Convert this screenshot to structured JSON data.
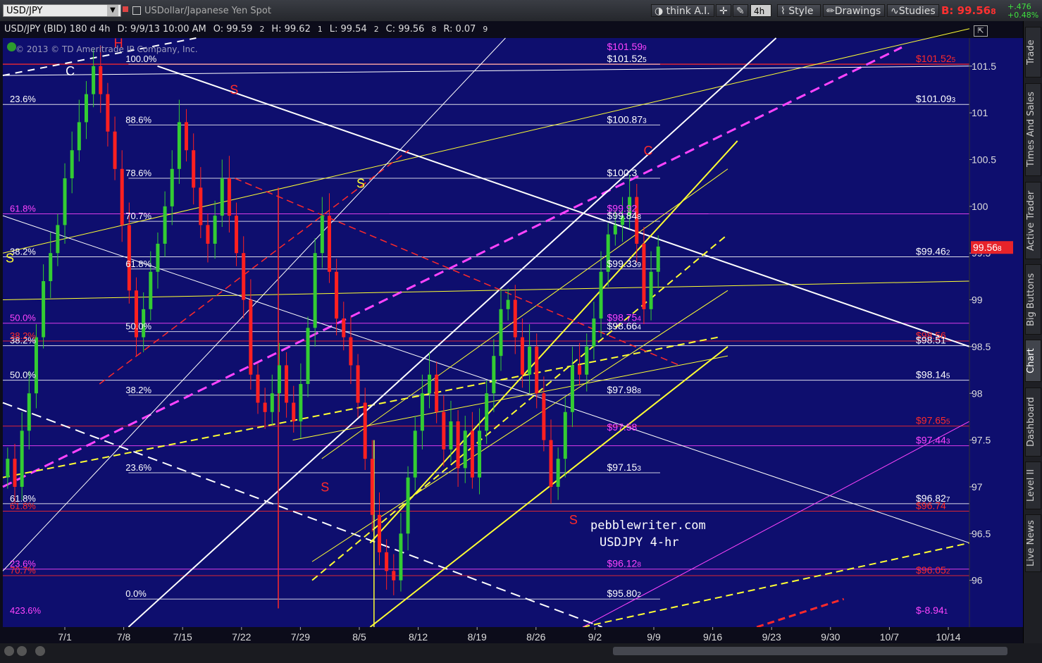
{
  "toolbar": {
    "symbol": "USD/JPY",
    "description": "USDollar/Japanese Yen Spot",
    "think": "think A.I.",
    "timeframe": "4h",
    "style": "Style",
    "drawings": "Drawings",
    "studies": "Studies",
    "bid": "B: 99.56",
    "bid_small": "8",
    "change": "+.476",
    "change_pct": "+0.48%"
  },
  "info": {
    "title": "USD/JPY (BID) 180 d 4h",
    "date": "D: 9/9/13 10:00 AM",
    "open": "O: 99.59",
    "open_small": "2",
    "high": "H: 99.62",
    "high_small": "1",
    "low": "L: 99.54",
    "low_small": "2",
    "close": "C: 99.56",
    "close_small": "8",
    "range": "R: 0.07",
    "range_small": "9"
  },
  "watermark": "© 2013 © TD Ameritrade IP Company, Inc.",
  "annotation": {
    "line1": "pebblewriter.com",
    "line2": "USDJPY 4-hr"
  },
  "side_tabs": [
    "Trade",
    "Times And Sales",
    "Active Trader",
    "Big Buttons",
    "Chart",
    "Dashboard",
    "Level II",
    "Live News"
  ],
  "colors": {
    "background": "#0e0e6e",
    "up": "#33cc33",
    "down": "#ff2020",
    "fib": "#ffffff",
    "magenta": "#ff44ff",
    "yellow": "#ffff33",
    "red": "#ff2a2a"
  },
  "chart_data": {
    "type": "candlestick",
    "y_axis": {
      "min": 95.5,
      "max": 101.8,
      "ticks": [
        "101.5",
        "101",
        "100.5",
        "100",
        "99.5",
        "99",
        "98.5",
        "98",
        "97.5",
        "97",
        "96.5",
        "96"
      ]
    },
    "x_ticks": [
      "7/1",
      "7/8",
      "7/15",
      "7/22",
      "7/29",
      "8/5",
      "8/12",
      "8/19",
      "8/26",
      "9/2",
      "9/9",
      "9/16",
      "9/23",
      "9/30",
      "10/7",
      "10/14"
    ],
    "last_price": "99.56",
    "last_price_small": "8",
    "price_labels": [
      {
        "text": "$101.52",
        "small": "5",
        "price": 101.52,
        "color": "#ff2a2a"
      },
      {
        "text": "$101.09",
        "small": "3",
        "price": 101.09,
        "color": "#ffffff"
      },
      {
        "text": "$99.46",
        "small": "2",
        "price": 99.46,
        "color": "#ffffff"
      },
      {
        "text": "$98.56",
        "small": "",
        "price": 98.56,
        "color": "#ff2a2a"
      },
      {
        "text": "$98.51",
        "small": "",
        "price": 98.51,
        "color": "#ffffff"
      },
      {
        "text": "$98.14",
        "small": "5",
        "price": 98.14,
        "color": "#ffffff"
      },
      {
        "text": "$97.65",
        "small": "5",
        "price": 97.65,
        "color": "#ff2a2a"
      },
      {
        "text": "$97.44",
        "small": "3",
        "price": 97.44,
        "color": "#ff44ff"
      },
      {
        "text": "$96.82",
        "small": "7",
        "price": 96.82,
        "color": "#ffffff"
      },
      {
        "text": "$96.74",
        "small": "",
        "price": 96.74,
        "color": "#ff2a2a"
      },
      {
        "text": "$96.05",
        "small": "2",
        "price": 96.05,
        "color": "#ff2a2a"
      },
      {
        "text": "$-8.94",
        "small": "1",
        "price": 95.62,
        "color": "#ff44ff"
      }
    ],
    "mid_labels": [
      {
        "text": "$101.52",
        "small": "5",
        "price": 101.52,
        "color": "#ffffff"
      },
      {
        "text": "$101.59",
        "small": "9",
        "price": 101.65,
        "color": "#ff44ff"
      },
      {
        "text": "$100.87",
        "small": "3",
        "price": 100.87,
        "color": "#ffffff"
      },
      {
        "text": "$100.3",
        "small": "",
        "price": 100.3,
        "color": "#ffffff"
      },
      {
        "text": "$99.92",
        "small": "",
        "price": 99.92,
        "color": "#ff44ff"
      },
      {
        "text": "$99.84",
        "small": "8",
        "price": 99.84,
        "color": "#ffffff"
      },
      {
        "text": "$99.33",
        "small": "9",
        "price": 99.33,
        "color": "#ffffff"
      },
      {
        "text": "$98.75",
        "small": "4",
        "price": 98.75,
        "color": "#ff44ff"
      },
      {
        "text": "$98.66",
        "small": "4",
        "price": 98.66,
        "color": "#ffffff"
      },
      {
        "text": "$97.98",
        "small": "8",
        "price": 97.98,
        "color": "#ffffff"
      },
      {
        "text": "$97.58",
        "small": "",
        "price": 97.58,
        "color": "#ff44ff"
      },
      {
        "text": "$97.15",
        "small": "3",
        "price": 97.15,
        "color": "#ffffff"
      },
      {
        "text": "$96.12",
        "small": "8",
        "price": 96.12,
        "color": "#ff44ff"
      },
      {
        "text": "$95.80",
        "small": "2",
        "price": 95.8,
        "color": "#ffffff"
      }
    ],
    "fib_left": [
      {
        "text": "23.6%",
        "price": 101.09,
        "color": "#ffffff"
      },
      {
        "text": "61.8%",
        "price": 99.92,
        "color": "#ff44ff"
      },
      {
        "text": "38.2%",
        "price": 99.46,
        "color": "#ffffff"
      },
      {
        "text": "50.0%",
        "price": 98.75,
        "color": "#ff44ff"
      },
      {
        "text": "38.2%",
        "price": 98.51,
        "color": "#ffffff"
      },
      {
        "text": "38.2%",
        "price": 98.56,
        "color": "#ff2a2a"
      },
      {
        "text": "50.0%",
        "price": 98.14,
        "color": "#ffffff"
      },
      {
        "text": "61.8%",
        "price": 96.82,
        "color": "#ffffff"
      },
      {
        "text": "61.8%",
        "price": 96.74,
        "color": "#ff2a2a"
      },
      {
        "text": "23.6%",
        "price": 96.12,
        "color": "#ff44ff"
      },
      {
        "text": "70.7%",
        "price": 96.05,
        "color": "#ff2a2a"
      },
      {
        "text": "423.6%",
        "price": 95.62,
        "color": "#ff44ff"
      }
    ],
    "fib_mid": [
      {
        "text": "100.0%",
        "price": 101.52
      },
      {
        "text": "88.6%",
        "price": 100.87
      },
      {
        "text": "78.6%",
        "price": 100.3
      },
      {
        "text": "70.7%",
        "price": 99.84
      },
      {
        "text": "61.8%",
        "price": 99.33
      },
      {
        "text": "50.0%",
        "price": 98.66
      },
      {
        "text": "38.2%",
        "price": 97.98
      },
      {
        "text": "23.6%",
        "price": 97.15
      },
      {
        "text": "0.0%",
        "price": 95.8
      }
    ],
    "letters": [
      {
        "t": "H",
        "color": "#ff2a2a",
        "x": 0.112,
        "price": 101.7
      },
      {
        "t": "C",
        "color": "#ffffff",
        "x": 0.062,
        "price": 101.4
      },
      {
        "t": "S",
        "color": "#ff2a2a",
        "x": 0.232,
        "price": 101.2
      },
      {
        "t": "S",
        "color": "#ffff33",
        "x": 0.363,
        "price": 100.2
      },
      {
        "t": "C",
        "color": "#ff2a2a",
        "x": 0.66,
        "price": 100.55
      },
      {
        "t": "S",
        "color": "#ff2a2a",
        "x": 0.326,
        "price": 96.95
      },
      {
        "t": "S",
        "color": "#ff2a2a",
        "x": 0.583,
        "price": 96.6
      },
      {
        "t": "S",
        "color": "#ffff33",
        "x": 0.0,
        "price": 99.4
      }
    ],
    "series": [
      {
        "name": "close",
        "values": [
          97.3,
          97.0,
          97.6,
          98.0,
          98.6,
          99.2,
          99.5,
          99.8,
          100.3,
          100.6,
          100.9,
          101.2,
          101.5,
          101.2,
          100.8,
          100.4,
          99.8,
          99.1,
          98.6,
          98.9,
          99.3,
          99.6,
          100.0,
          100.4,
          100.9,
          100.6,
          100.2,
          99.8,
          99.6,
          99.9,
          100.3,
          99.9,
          99.5,
          99.0,
          98.2,
          97.9,
          97.8,
          98.0,
          98.3,
          97.9,
          97.7,
          98.1,
          98.7,
          99.5,
          99.9,
          99.3,
          98.8,
          98.6,
          98.3,
          97.9,
          97.3,
          96.7,
          96.3,
          96.1,
          96.0,
          96.5,
          97.1,
          97.6,
          98.0,
          98.2,
          97.8,
          97.4,
          97.7,
          97.2,
          97.6,
          97.1,
          97.6,
          98.0,
          98.4,
          98.9,
          99.0,
          98.6,
          98.2,
          98.5,
          98.0,
          97.5,
          97.0,
          97.3,
          97.8,
          98.3,
          98.2,
          98.5,
          98.8,
          99.3,
          99.7,
          99.8,
          99.9,
          100.1,
          99.6,
          98.9,
          99.3,
          99.57
        ]
      }
    ]
  }
}
